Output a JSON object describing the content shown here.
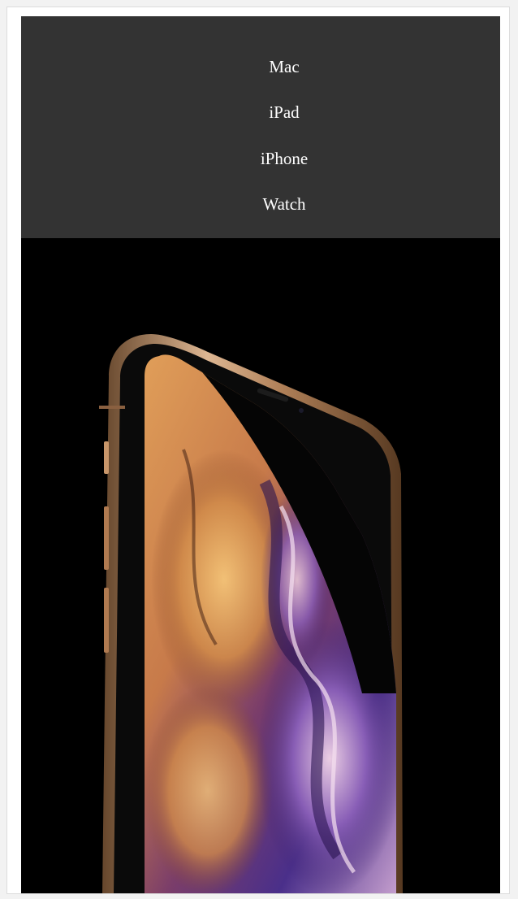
{
  "nav": {
    "items": [
      {
        "label": "Mac"
      },
      {
        "label": "iPad"
      },
      {
        "label": "iPhone"
      },
      {
        "label": "Watch"
      }
    ]
  },
  "hero": {
    "image_icon": "iphone-xs-product-image",
    "background_color": "#000000"
  },
  "colors": {
    "nav_background": "#333333",
    "nav_text": "#ffffff",
    "page_background": "#ffffff"
  }
}
